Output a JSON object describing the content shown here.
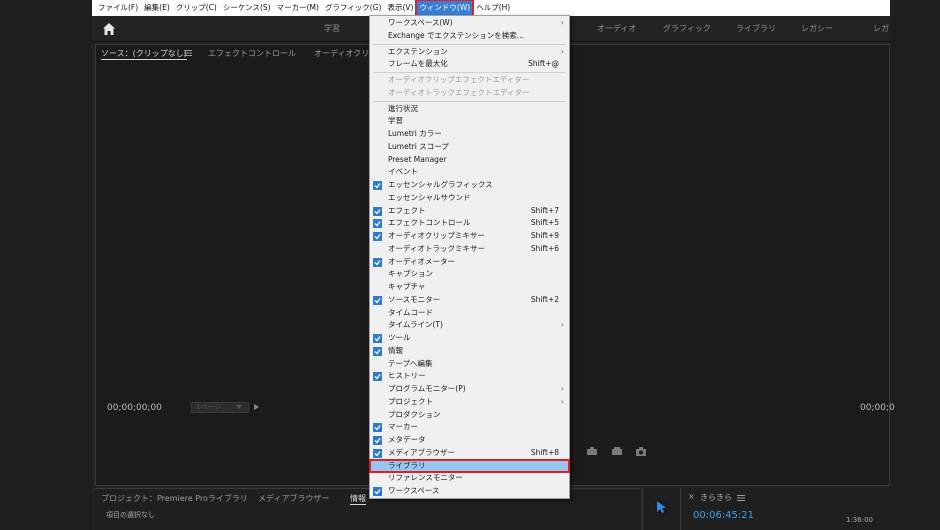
{
  "menubar": {
    "items": [
      "ファイル(F)",
      "編集(E)",
      "クリップ(C)",
      "シーケンス(S)",
      "マーカー(M)",
      "グラフィック(G)",
      "表示(V)",
      "ウィンドウ(W)",
      "ヘルプ(H)"
    ],
    "active_index": 7
  },
  "workspace": {
    "tabs": [
      "学習",
      "オーディオ",
      "グラフィック",
      "ライブラリ",
      "レガシー",
      "レガ"
    ]
  },
  "source_panel": {
    "tabs": [
      "ソース：(クリップなし)",
      "エフェクトコントロール",
      "オーディオクリ"
    ],
    "timecode_left": "00;00;00;00",
    "timecode_right": "00;00;0",
    "zoom_value": "1ページ"
  },
  "project_panel": {
    "tabs": [
      "プロジェクト：Premiere Proライブラリ",
      "メディアブラウザー",
      "情報"
    ],
    "status": "項目の選択なし"
  },
  "timeline_panel": {
    "close": "×",
    "sequence_name": "きらきら",
    "timecode": "00:06:45:21",
    "end_time": "1:36:00"
  },
  "dropdown": {
    "items": [
      {
        "label": "ワークスペース(W)",
        "checked": false,
        "shortcut": "",
        "submenu": true,
        "disabled": false
      },
      {
        "label": "Exchange でエクステンションを検索...",
        "checked": false,
        "shortcut": "",
        "submenu": false,
        "disabled": false
      },
      {
        "label": "エクステンション",
        "checked": false,
        "shortcut": "",
        "submenu": true,
        "disabled": false
      },
      {
        "label": "フレームを最大化",
        "checked": false,
        "shortcut": "Shift+@",
        "submenu": false,
        "disabled": false
      },
      {
        "label": "オーディオクリップエフェクトエディター",
        "checked": false,
        "shortcut": "",
        "submenu": false,
        "disabled": true
      },
      {
        "label": "オーディオトラックエフェクトエディター",
        "checked": false,
        "shortcut": "",
        "submenu": false,
        "disabled": true
      },
      {
        "label": "進行状況",
        "checked": false,
        "shortcut": "",
        "submenu": false,
        "disabled": false
      },
      {
        "label": "学習",
        "checked": false,
        "shortcut": "",
        "submenu": false,
        "disabled": false
      },
      {
        "label": "Lumetri カラー",
        "checked": false,
        "shortcut": "",
        "submenu": false,
        "disabled": false
      },
      {
        "label": "Lumetri スコープ",
        "checked": false,
        "shortcut": "",
        "submenu": false,
        "disabled": false
      },
      {
        "label": "Preset Manager",
        "checked": false,
        "shortcut": "",
        "submenu": false,
        "disabled": false
      },
      {
        "label": "イベント",
        "checked": false,
        "shortcut": "",
        "submenu": false,
        "disabled": false
      },
      {
        "label": "エッセンシャルグラフィックス",
        "checked": true,
        "shortcut": "",
        "submenu": false,
        "disabled": false
      },
      {
        "label": "エッセンシャルサウンド",
        "checked": false,
        "shortcut": "",
        "submenu": false,
        "disabled": false
      },
      {
        "label": "エフェクト",
        "checked": true,
        "shortcut": "Shift+7",
        "submenu": false,
        "disabled": false
      },
      {
        "label": "エフェクトコントロール",
        "checked": true,
        "shortcut": "Shift+5",
        "submenu": false,
        "disabled": false
      },
      {
        "label": "オーディオクリップミキサー",
        "checked": true,
        "shortcut": "Shift+9",
        "submenu": false,
        "disabled": false
      },
      {
        "label": "オーディオトラックミキサー",
        "checked": false,
        "shortcut": "Shift+6",
        "submenu": false,
        "disabled": false
      },
      {
        "label": "オーディオメーター",
        "checked": true,
        "shortcut": "",
        "submenu": false,
        "disabled": false
      },
      {
        "label": "キャプション",
        "checked": false,
        "shortcut": "",
        "submenu": false,
        "disabled": false
      },
      {
        "label": "キャプチャ",
        "checked": false,
        "shortcut": "",
        "submenu": false,
        "disabled": false
      },
      {
        "label": "ソースモニター",
        "checked": true,
        "shortcut": "Shift+2",
        "submenu": false,
        "disabled": false
      },
      {
        "label": "タイムコード",
        "checked": false,
        "shortcut": "",
        "submenu": false,
        "disabled": false
      },
      {
        "label": "タイムライン(T)",
        "checked": false,
        "shortcut": "",
        "submenu": true,
        "disabled": false
      },
      {
        "label": "ツール",
        "checked": true,
        "shortcut": "",
        "submenu": false,
        "disabled": false
      },
      {
        "label": "情報",
        "checked": true,
        "shortcut": "",
        "submenu": false,
        "disabled": false
      },
      {
        "label": "テープへ編集",
        "checked": false,
        "shortcut": "",
        "submenu": false,
        "disabled": false
      },
      {
        "label": "ヒストリー",
        "checked": true,
        "shortcut": "",
        "submenu": false,
        "disabled": false
      },
      {
        "label": "プログラムモニター(P)",
        "checked": false,
        "shortcut": "",
        "submenu": true,
        "disabled": false
      },
      {
        "label": "プロジェクト",
        "checked": false,
        "shortcut": "",
        "submenu": true,
        "disabled": false
      },
      {
        "label": "プロダクション",
        "checked": false,
        "shortcut": "",
        "submenu": false,
        "disabled": false
      },
      {
        "label": "マーカー",
        "checked": true,
        "shortcut": "",
        "submenu": false,
        "disabled": false
      },
      {
        "label": "メタデータ",
        "checked": true,
        "shortcut": "",
        "submenu": false,
        "disabled": false
      },
      {
        "label": "メディアブラウザー",
        "checked": true,
        "shortcut": "Shift+8",
        "submenu": false,
        "disabled": false
      },
      {
        "label": "ライブラリ",
        "checked": false,
        "shortcut": "",
        "submenu": false,
        "disabled": false,
        "highlight": true
      },
      {
        "label": "リファレンスモニター",
        "checked": false,
        "shortcut": "",
        "submenu": false,
        "disabled": false
      },
      {
        "label": "ワークスペース",
        "checked": true,
        "shortcut": "",
        "submenu": false,
        "disabled": false
      }
    ]
  },
  "colors": {
    "accent_blue": "#3f9fea",
    "highlight_red": "#e01f26",
    "menu_highlight": "#97c6ee",
    "check_blue": "#2f7ccc"
  }
}
